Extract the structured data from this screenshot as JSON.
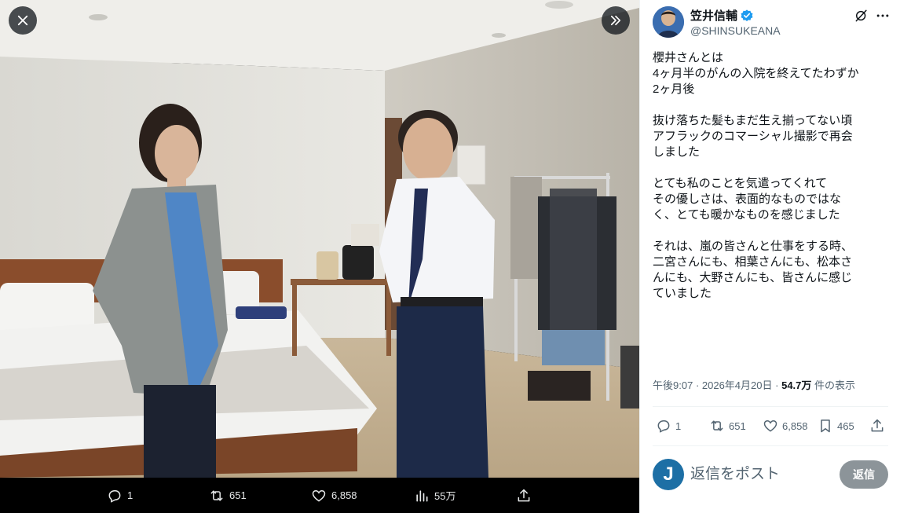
{
  "viewer": {
    "close_icon": "close-icon",
    "expand_icon": "double-chevron-right-icon",
    "actions": {
      "reply_count": "1",
      "retweet_count": "651",
      "like_count": "6,858",
      "view_count": "55万"
    }
  },
  "tweet": {
    "display_name": "笠井信輔",
    "handle": "@SHINSUKEANA",
    "verified_color": "#1d9bf0",
    "text_lines": [
      "櫻井さんとは",
      "4ヶ月半のがんの入院を終えてたわずか",
      "2ヶ月後",
      "",
      "抜け落ちた髪もまだ生え揃ってない頃",
      "アフラックのコマーシャル撮影で再会",
      "しました",
      "",
      "とても私のことを気遣ってくれて",
      "その優しさは、表面的なものではな",
      "く、とても暖かなものを感じました",
      "",
      "それは、嵐の皆さんと仕事をする時、",
      "二宮さんにも、相葉さんにも、松本さ",
      "んにも、大野さんにも、皆さんに感じ",
      "ていました"
    ],
    "time": "午後9:07",
    "date": "2026年4月20日",
    "views": "54.7万",
    "views_label": "件の表示",
    "separator": "·",
    "reply_count": "1",
    "retweet_count": "651",
    "like_count": "6,858",
    "bookmark_count": "465"
  },
  "reply": {
    "placeholder": "返信をポスト",
    "button_label": "返信",
    "avatar_letter": "J"
  }
}
